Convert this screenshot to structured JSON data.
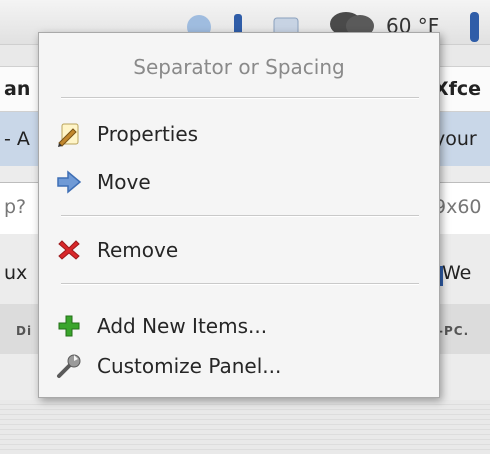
{
  "panel": {
    "weather_text": "60 °F"
  },
  "background": {
    "row1_left": "an",
    "row1_right": "Xfce",
    "row2_left": "- A",
    "row2_right": "your",
    "row3_left": "p?",
    "row3_right": "9x60",
    "row4_left": "ux",
    "row4_right": "We",
    "row5_left": "Di",
    "row5_right": "-PC."
  },
  "menu": {
    "title": "Separator or Spacing",
    "items": [
      {
        "label": "Properties",
        "icon": "properties-icon"
      },
      {
        "label": "Move",
        "icon": "move-arrow-icon"
      },
      {
        "label": "Remove",
        "icon": "remove-x-icon"
      },
      {
        "label": "Add New Items...",
        "icon": "add-plus-icon"
      },
      {
        "label": "Customize Panel...",
        "icon": "wrench-icon"
      }
    ]
  },
  "colors": {
    "remove_icon": "#d9272a",
    "add_icon": "#3aa52c",
    "move_icon": "#3f6fb5"
  }
}
